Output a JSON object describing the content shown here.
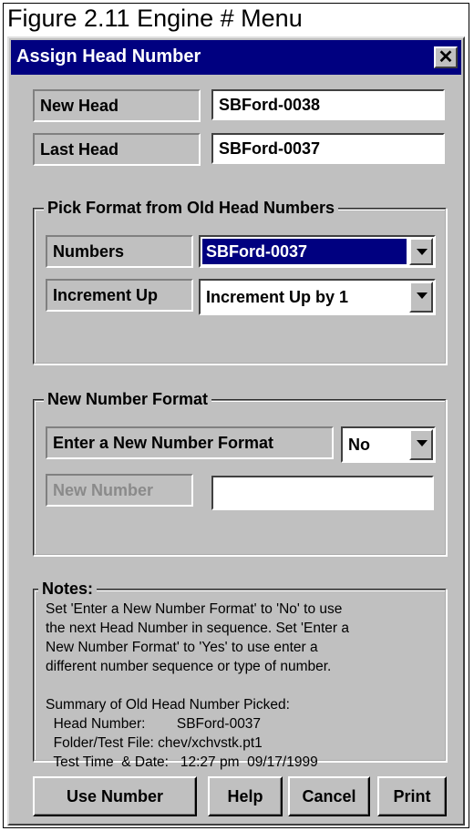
{
  "figure": {
    "caption": "Figure 2.11  Engine # Menu"
  },
  "window": {
    "title": "Assign Head Number",
    "close_glyph": "✕",
    "close_icon": "close-icon"
  },
  "head": {
    "new_label": "New Head",
    "new_value": "SBFord-0038",
    "last_label": "Last Head",
    "last_value": "SBFord-0037"
  },
  "pick_format": {
    "group_title": "Pick Format from Old Head Numbers",
    "numbers_label": "Numbers",
    "numbers_value": "SBFord-0037",
    "increment_label": "Increment Up",
    "increment_value": "Increment Up by 1"
  },
  "new_format": {
    "group_title": "New Number Format",
    "enter_label": "Enter a New Number Format",
    "enter_value": "No",
    "new_number_label": "New Number",
    "new_number_value": ""
  },
  "notes": {
    "group_title": "Notes:",
    "lines": [
      "Set 'Enter a New Number Format' to 'No' to use",
      "the next Head Number in sequence.  Set 'Enter a",
      "New Number Format' to 'Yes' to use enter a",
      "different number sequence or type of number.",
      "",
      "Summary of Old Head Number Picked:",
      "  Head Number:        SBFord-0037",
      "  Folder/Test File: chev/xchvstk.pt1",
      "  Test Time  & Date:   12:27 pm  09/17/1999"
    ]
  },
  "buttons": {
    "use_number": "Use Number",
    "help": "Help",
    "cancel": "Cancel",
    "print": "Print"
  }
}
